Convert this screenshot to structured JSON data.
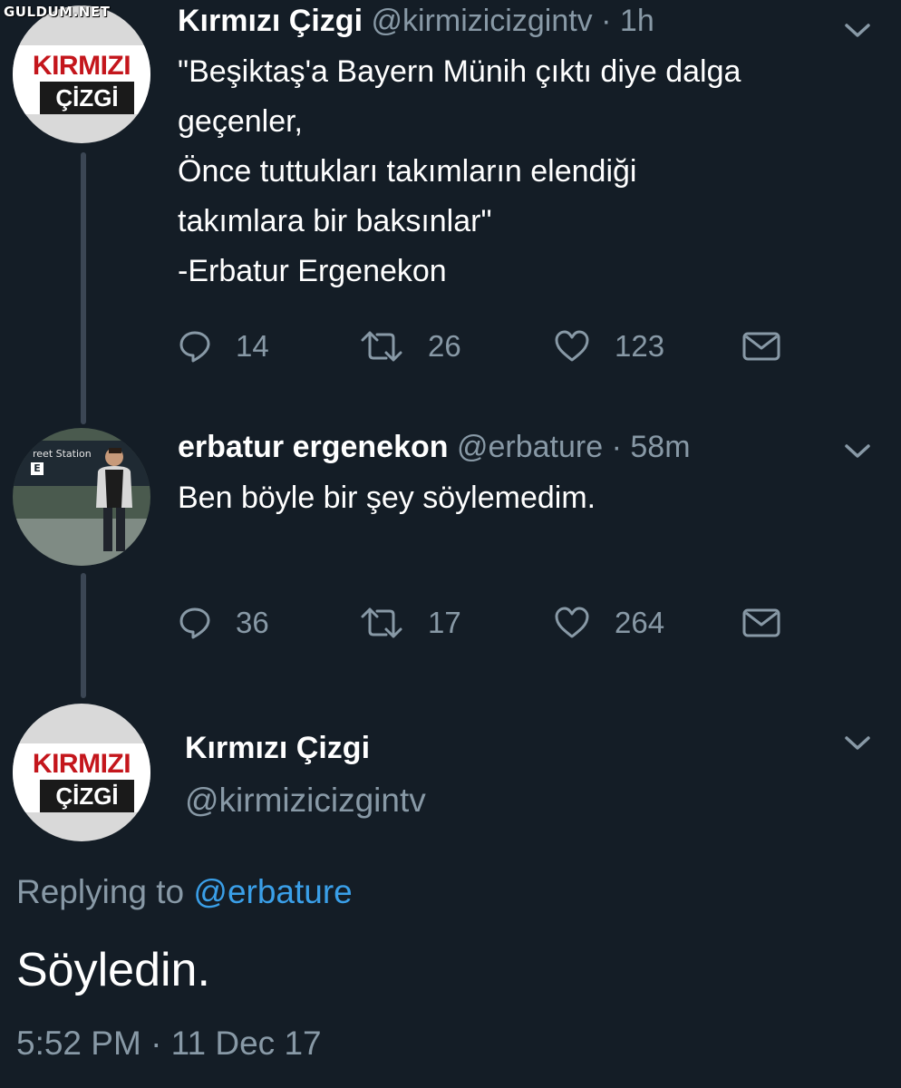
{
  "watermark": "GULDUM.NET",
  "tweets": [
    {
      "name": "Kırmızı Çizgi",
      "handle": "@kirmizicizgintv",
      "time": "1h",
      "avatar_logo": {
        "top": "KIRMIZI",
        "bottom": "ÇİZGİ"
      },
      "body_lines": [
        "\"Beşiktaş'a Bayern Münih çıktı diye dalga",
        "geçenler,",
        "Önce tuttukları takımların elendiği",
        "takımlara bir baksınlar\"",
        "-Erbatur Ergenekon"
      ],
      "replies": "14",
      "retweets": "26",
      "likes": "123"
    },
    {
      "name": "erbatur ergenekon",
      "handle": "@erbature",
      "time": "58m",
      "avatar_sign": {
        "text": "reet Station",
        "badge": "E"
      },
      "body_lines": [
        "Ben böyle bir şey söylemedim."
      ],
      "replies": "36",
      "retweets": "17",
      "likes": "264"
    }
  ],
  "main_tweet": {
    "name": "Kırmızı Çizgi",
    "handle": "@kirmizicizgintv",
    "avatar_logo": {
      "top": "KIRMIZI",
      "bottom": "ÇİZGİ"
    },
    "replying_to_label": "Replying to",
    "replying_to_handle": "@erbature",
    "text": "Söyledin.",
    "timestamp": "5:52 PM · 11 Dec 17"
  },
  "separator": "·",
  "icons": {
    "reply": "reply-icon",
    "retweet": "retweet-icon",
    "like": "heart-icon",
    "dm": "envelope-icon",
    "menu": "chevron-down-icon"
  },
  "colors": {
    "background": "#141d26",
    "secondary_text": "#8899a6",
    "link": "#3a9fe8",
    "brand_red": "#c4161c"
  }
}
